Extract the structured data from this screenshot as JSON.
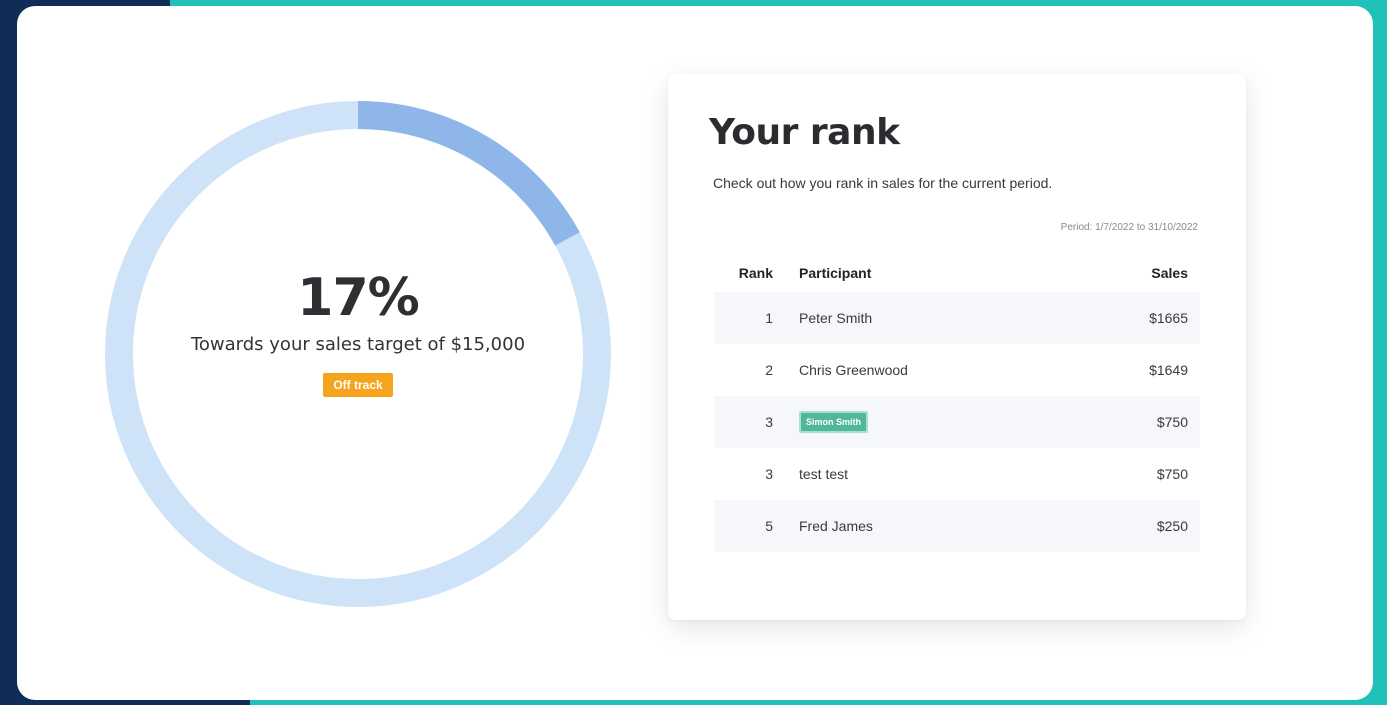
{
  "progress": {
    "percent_label": "17%",
    "fraction": 0.17,
    "subtitle": "Towards your sales target of $15,000",
    "status": "Off track"
  },
  "rank_panel": {
    "title": "Your rank",
    "description": "Check out how you rank in sales for the current period.",
    "period": "Period: 1/7/2022 to 31/10/2022",
    "columns": {
      "rank": "Rank",
      "participant": "Participant",
      "sales": "Sales"
    },
    "rows": [
      {
        "rank": "1",
        "participant": "Peter Smith",
        "sales": "$1665"
      },
      {
        "rank": "2",
        "participant": "Chris Greenwood",
        "sales": "$1649"
      },
      {
        "rank": "3",
        "participant": "Simon Smith",
        "sales": "$750",
        "is_you": true
      },
      {
        "rank": "3",
        "participant": "test test",
        "sales": "$750"
      },
      {
        "rank": "5",
        "participant": "Fred James",
        "sales": "$250"
      }
    ]
  },
  "colors": {
    "track": "#cfe3f8",
    "progress": "#8fb6e8",
    "badge_off": "#f6a41d",
    "badge_you": "#4fb89a",
    "border_teal": "#1fc1b8",
    "border_navy": "#0f2d57"
  }
}
